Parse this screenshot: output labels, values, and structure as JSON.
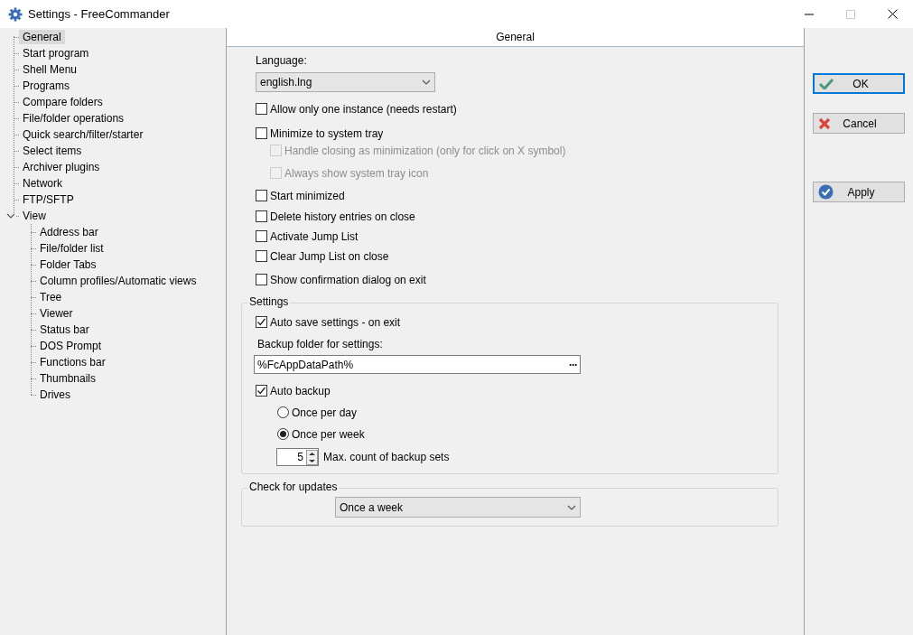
{
  "window": {
    "title": "Settings - FreeCommander"
  },
  "tree": [
    {
      "label": "General",
      "selected": true
    },
    {
      "label": "Start program",
      "selected": false
    },
    {
      "label": "Shell Menu",
      "selected": false
    },
    {
      "label": "Programs",
      "selected": false
    },
    {
      "label": "Compare folders",
      "selected": false
    },
    {
      "label": "File/folder operations",
      "selected": false
    },
    {
      "label": "Quick search/filter/starter",
      "selected": false
    },
    {
      "label": "Select items",
      "selected": false
    },
    {
      "label": "Archiver plugins",
      "selected": false
    },
    {
      "label": "Network",
      "selected": false
    },
    {
      "label": "FTP/SFTP",
      "selected": false
    },
    {
      "label": "View",
      "selected": false,
      "expanded": true,
      "children": [
        {
          "label": "Address bar",
          "selected": false
        },
        {
          "label": "File/folder list",
          "selected": false
        },
        {
          "label": "Folder Tabs",
          "selected": false
        },
        {
          "label": "Column profiles/Automatic views",
          "selected": false
        },
        {
          "label": "Tree",
          "selected": false
        },
        {
          "label": "Viewer",
          "selected": false
        },
        {
          "label": "Status bar",
          "selected": false
        },
        {
          "label": "DOS Prompt",
          "selected": false
        },
        {
          "label": "Functions bar",
          "selected": false
        },
        {
          "label": "Thumbnails",
          "selected": false
        },
        {
          "label": "Drives",
          "selected": false
        }
      ]
    }
  ],
  "panel": {
    "title": "General",
    "language": {
      "label": "Language:",
      "value": "english.lng"
    },
    "options": [
      {
        "label": "Allow only one instance (needs restart)",
        "checked": false,
        "disabled": false,
        "indented": false
      },
      {
        "label": "Minimize to system tray",
        "checked": false,
        "disabled": false,
        "indented": false
      },
      {
        "label": "Handle closing as minimization (only for click on X symbol)",
        "checked": false,
        "disabled": true,
        "indented": true
      },
      {
        "label": "Always show system tray icon",
        "checked": false,
        "disabled": true,
        "indented": true
      },
      {
        "label": "Start minimized",
        "checked": false,
        "disabled": false,
        "indented": false
      },
      {
        "label": "Delete history entries on close",
        "checked": false,
        "disabled": false,
        "indented": false
      },
      {
        "label": "Activate Jump List",
        "checked": false,
        "disabled": false,
        "indented": false
      },
      {
        "label": "Clear Jump List on close",
        "checked": false,
        "disabled": false,
        "indented": false
      },
      {
        "label": "Show confirmation dialog on exit",
        "checked": false,
        "disabled": false,
        "indented": false
      }
    ],
    "settings": {
      "title": "Settings",
      "auto_save": {
        "label": "Auto save settings - on exit",
        "checked": true
      },
      "backup_folder": {
        "label": "Backup folder for settings:",
        "value": "%FcAppDataPath%",
        "browse": "···"
      },
      "auto_backup": {
        "label": "Auto backup",
        "checked": true
      },
      "frequency": [
        {
          "label": "Once per day",
          "selected": false
        },
        {
          "label": "Once per week",
          "selected": true
        }
      ],
      "max_count": {
        "value": "5",
        "label": "Max. count of backup sets"
      }
    },
    "updates": {
      "title": "Check for updates",
      "value": "Once a week"
    }
  },
  "buttons": [
    {
      "kind": "ok",
      "label": "OK",
      "focused": true
    },
    {
      "kind": "cancel",
      "label": "Cancel",
      "focused": false
    },
    {
      "kind": "apply",
      "label": "Apply",
      "focused": false
    }
  ]
}
